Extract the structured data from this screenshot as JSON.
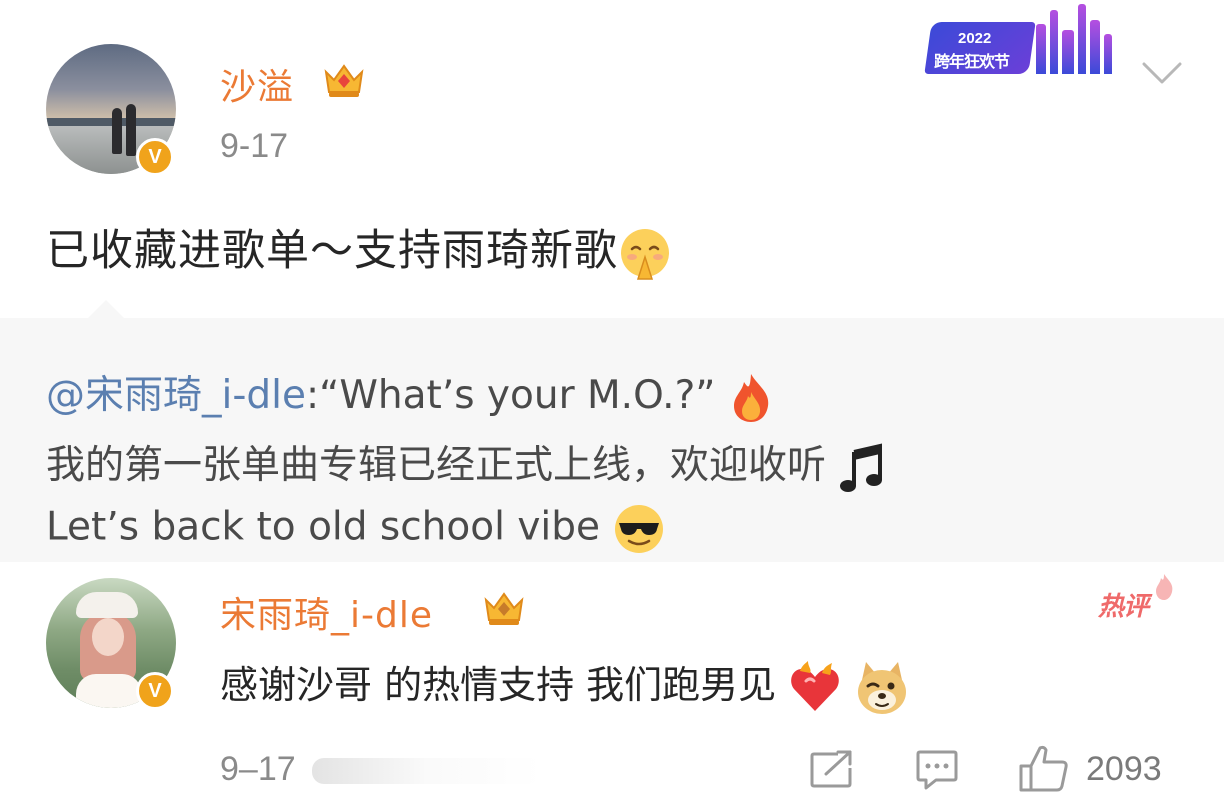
{
  "post": {
    "author": "沙溢",
    "verified_badge": "V",
    "timestamp": "9-17",
    "text": "已收藏进歌单～支持雨琦新歌",
    "text_emoji": "pray-smile-emoji",
    "festival_badge": {
      "year": "2022",
      "title": "跨年狂欢节"
    }
  },
  "repost": {
    "mention": "@宋雨琦_i-dle",
    "line1_text": ":“What’s your M.O.?”",
    "line1_emoji": "fire-emoji",
    "line2_text": "我的第一张单曲专辑已经正式上线，欢迎收听",
    "line2_emoji": "music-note-emoji",
    "line3_text": "Let’s back to old school vibe",
    "line3_emoji": "sunglasses-emoji"
  },
  "comment": {
    "author": "宋雨琦_i-dle",
    "verified_badge": "V",
    "hot_label": "热评",
    "text": "感谢沙哥 的热情支持 我们跑男见",
    "emojis": [
      "heart-on-fire-emoji",
      "doge-emoji"
    ],
    "timestamp": "9–17",
    "like_count": "2093"
  },
  "icons": {
    "post_menu": "chevron-down-icon",
    "share": "share-icon",
    "comment": "comment-icon",
    "like": "thumbs-up-icon"
  },
  "colors": {
    "username": "#eb7a35",
    "mention": "#5b7fb0",
    "verified": "#f0a31b",
    "hot_comment": "#ef6a6a",
    "repost_bg": "#f7f7f7"
  }
}
